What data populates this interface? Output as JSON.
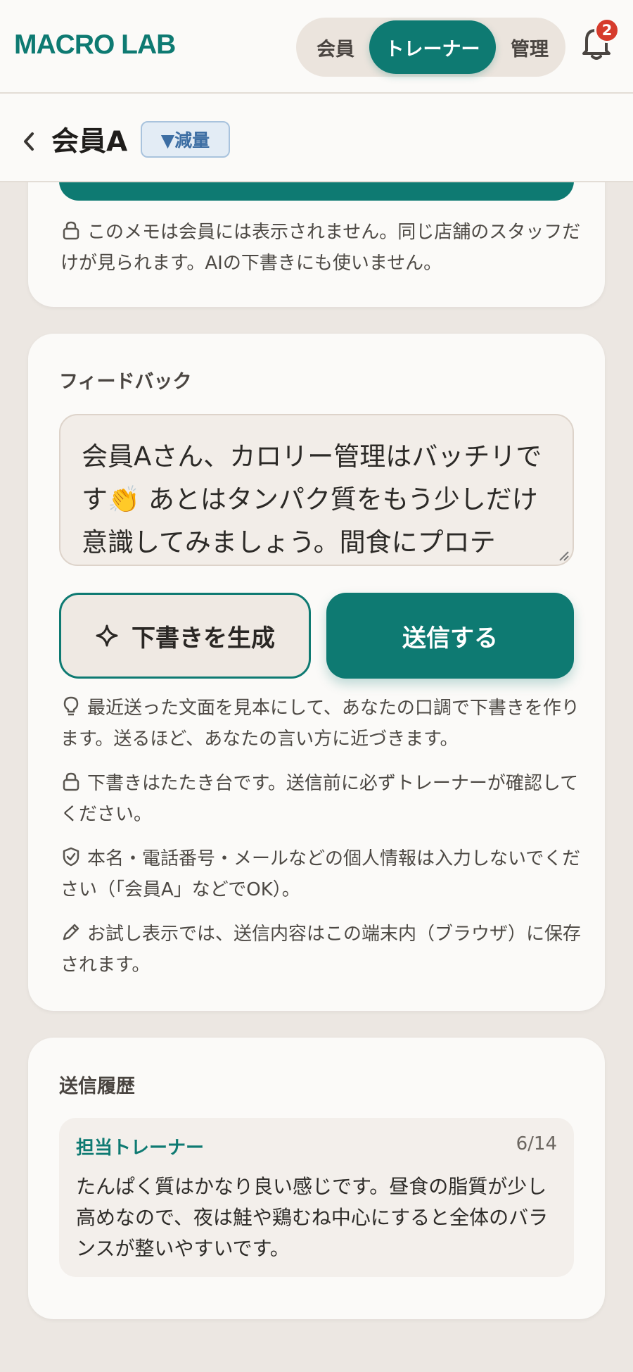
{
  "app": {
    "brand": "MACRO LAB"
  },
  "header": {
    "roles": [
      "会員",
      "トレーナー",
      "管理"
    ],
    "active_role": "トレーナー",
    "notifications": "2"
  },
  "subheader": {
    "member_name": "会員A",
    "goal_tag": "▼減量"
  },
  "memo_card": {
    "privacy_note": "このメモは会員には表示されません。同じ店舗のスタッフだけが見られます。AIの下書きにも使いません。"
  },
  "feedback": {
    "label": "フィードバック",
    "text": "会員Aさん、カロリー管理はバッチリです👏 あとはタンパク質をもう少しだけ意識してみましょう。間食にプロテ",
    "draft_button": "下書きを生成",
    "send_button": "送信する",
    "notes": [
      "最近送った文面を見本にして、あなたの口調で下書きを作ります。送るほど、あなたの言い方に近づきます。",
      "下書きはたたき台です。送信前に必ずトレーナーが確認してください。",
      "本名・電話番号・メールなどの個人情報は入力しないでください（「会員A」などでOK）。",
      "お試し表示では、送信内容はこの端末内（ブラウザ）に保存されます。"
    ]
  },
  "history": {
    "label": "送信履歴",
    "items": [
      {
        "author": "担当トレーナー",
        "date": "6/14",
        "text": "たんぱく質はかなり良い感じです。昼食の脂質が少し高めなので、夜は鮭や鶏むね中心にすると全体のバランスが整いやすいです。"
      }
    ]
  },
  "colors": {
    "accent": "#0e7a72",
    "badge": "#d63b2c",
    "goal_tag": "#3d6ea3"
  }
}
